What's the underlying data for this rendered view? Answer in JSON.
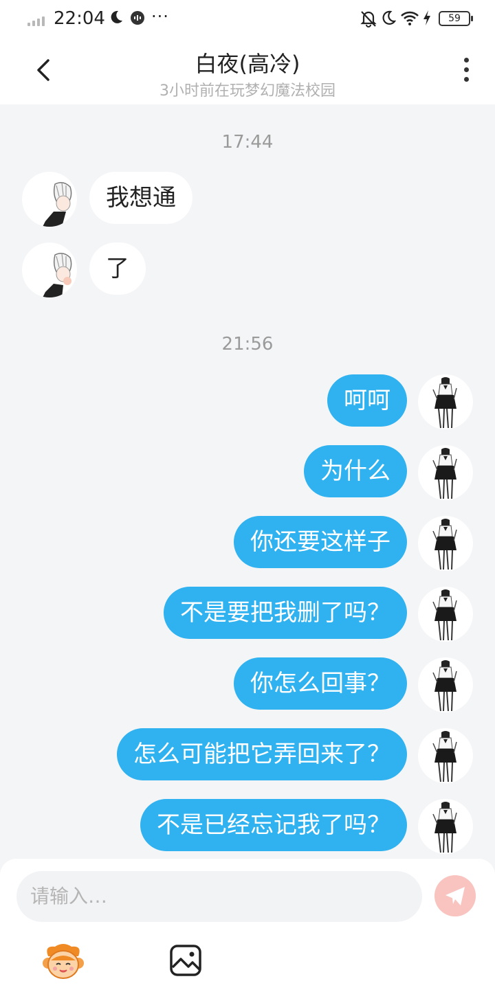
{
  "status_bar": {
    "time": "22:04",
    "battery": "59",
    "more": "···",
    "icons": [
      "signal-icon",
      "moon-icon",
      "voice-app-icon",
      "mute-bell-icon",
      "moon-icon",
      "wifi-icon",
      "charging-icon",
      "battery-icon"
    ]
  },
  "header": {
    "title": "白夜(高冷)",
    "subtitle": "3小时前在玩梦幻魔法校园",
    "back_icon": "chevron-left-icon",
    "menu_icon": "more-vertical-icon"
  },
  "chat": {
    "timestamps": [
      "17:44",
      "21:56"
    ],
    "incoming": [
      "我想通",
      "了"
    ],
    "outgoing": [
      "呵呵",
      "为什么",
      "你还要这样子",
      "不是要把我删了吗？",
      "你怎么回事？",
      "怎么可能把它弄回来了？",
      "不是已经忘记我了吗？"
    ]
  },
  "composer": {
    "placeholder": "请输入…",
    "send_icon": "paper-plane-icon",
    "toolbar_icons": [
      "emoji-mascot-icon",
      "image-icon"
    ]
  },
  "colors": {
    "outgoing_bubble": "#2fb2ef",
    "incoming_bubble": "#ffffff",
    "background": "#f4f5f7",
    "send_button": "#f9c4c0"
  }
}
